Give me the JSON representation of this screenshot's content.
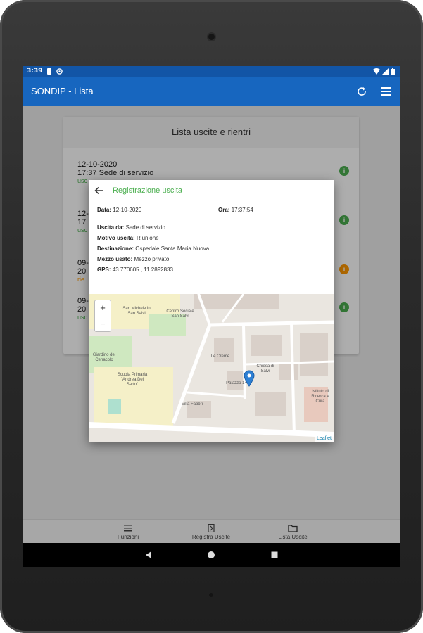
{
  "status_bar": {
    "time": "3:39"
  },
  "app_bar": {
    "title": "SONDIP - Lista",
    "refresh_icon": "refresh-icon",
    "menu_icon": "menu-icon"
  },
  "list": {
    "header": "Lista uscite e rientri",
    "items": [
      {
        "date": "12-10-2020",
        "time_place": "17:37 Sede di servizio",
        "status": "usc",
        "status_color": "#4caf50",
        "info_color": "#4caf50"
      },
      {
        "date": "12-",
        "time_place": "17",
        "status": "usc",
        "status_color": "#4caf50",
        "info_color": "#4caf50"
      },
      {
        "date": "09-",
        "time_place": "20",
        "status": "rie",
        "status_color": "#ff9800",
        "info_color": "#ff9800"
      },
      {
        "date": "09-",
        "time_place": "20",
        "status": "usc",
        "status_color": "#4caf50",
        "info_color": "#4caf50"
      }
    ]
  },
  "dialog": {
    "title": "Registrazione uscita",
    "data_label": "Data:",
    "data_value": "12-10-2020",
    "ora_label": "Ora:",
    "ora_value": "17:37:54",
    "uscita_label": "Uscita da:",
    "uscita_value": "Sede di servizio",
    "motivo_label": "Motivo uscita:",
    "motivo_value": "Riunione",
    "destinazione_label": "Destinazione:",
    "destinazione_value": "Ospedale Santa Maria Nuova",
    "mezzo_label": "Mezzo usato:",
    "mezzo_value": "Mezzo privato",
    "gps_label": "GPS:",
    "gps_value": "43.770605 , 11.2892833"
  },
  "map": {
    "zoom_in": "+",
    "zoom_out": "−",
    "attribution": "Leaflet",
    "labels": [
      "San Michele in San Salvi",
      "Centro Sociale San Salvi",
      "Giardino del Cenacolo",
      "Scuola Primaria \"Andrea Del Sarto\"",
      "Villa Fabbri",
      "Palazzo 14",
      "Le Creme",
      "Chiesa di Salvi",
      "Istituto di Ricerca e Cura"
    ]
  },
  "bottom_nav": [
    {
      "label": "Funzioni",
      "icon": "list-icon"
    },
    {
      "label": "Registra Uscite",
      "icon": "exit-door-icon"
    },
    {
      "label": "Lista Uscite",
      "icon": "folder-icon"
    }
  ],
  "colors": {
    "primary": "#1766bf",
    "status_bar": "#1255a6",
    "accent_green": "#4caf50",
    "accent_orange": "#ff9800",
    "pin": "#2d7fd3"
  }
}
